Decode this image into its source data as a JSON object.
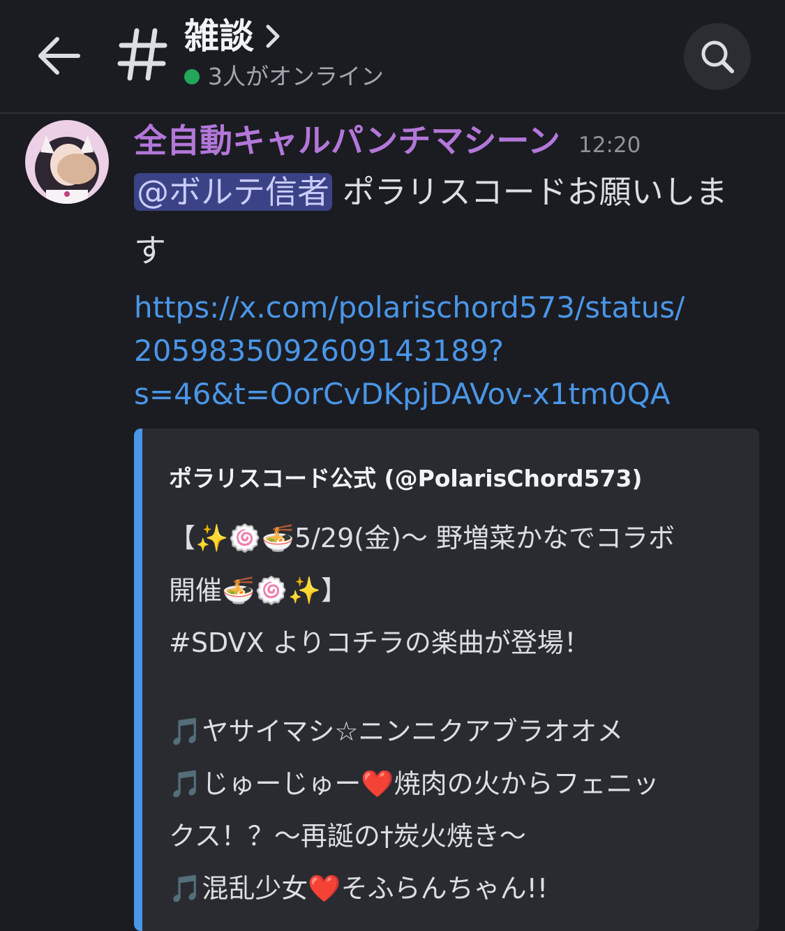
{
  "header": {
    "channel_name": "雑談",
    "online_text": "3人がオンライン",
    "back_icon": "arrow-left-icon",
    "channel_icon": "hash-icon",
    "search_icon": "search-icon"
  },
  "message": {
    "author": "全自動キャルパンチマシーン",
    "timestamp": "12:20",
    "mention": "@ボルテ信者",
    "text_line1": " ポラリスコードお願いしま",
    "text_line2": "す",
    "link_line1": "https://x.com/polarischord573/status/",
    "link_line2": "2059835092609143189?",
    "link_line3": "s=46&t=OorCvDKpjDAVov-x1tm0QA"
  },
  "embed": {
    "author": "ポラリスコード公式 (@PolarisChord573)",
    "lines": [
      "【✨🍥🍜5/29(金)〜 野増菜かなでコラボ",
      "開催🍜🍥✨】",
      "#SDVX よりコチラの楽曲が登場！",
      "",
      "🎵ヤサイマシ☆ニンニクアブラオオメ",
      "🎵じゅーじゅー❤️焼肉の火からフェニッ",
      "クス！？〜再誕の†炭火焼き〜",
      "🎵混乱少女❤️そふらんちゃん!!"
    ]
  },
  "colors": {
    "background": "#1b1c21",
    "author_color": "#b377d9",
    "link_color": "#4a96e8",
    "mention_bg": "#3b4285",
    "online_dot": "#23a55a"
  }
}
